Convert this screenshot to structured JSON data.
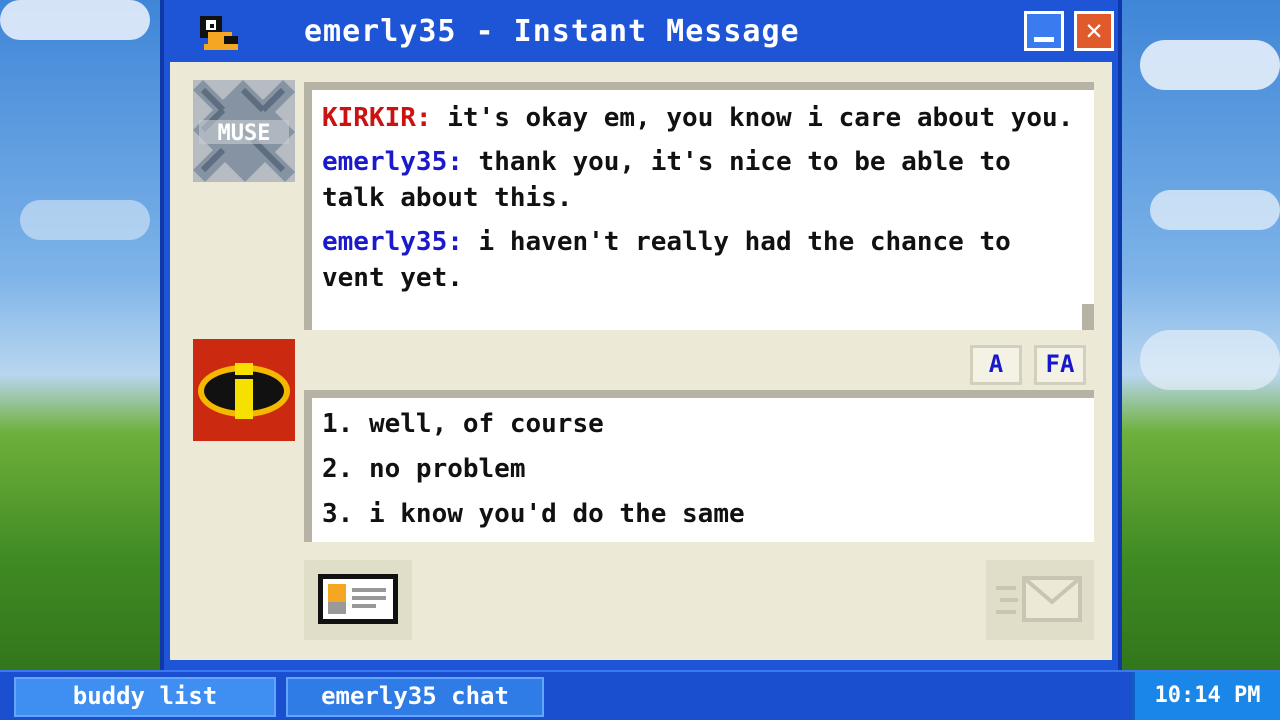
{
  "window": {
    "title": "emerly35 - Instant Message",
    "close_glyph": "✕",
    "icons": {
      "app": "duck-messenger-icon",
      "minimize": "minimize-icon",
      "close": "close-icon"
    }
  },
  "buddy_avatar": {
    "icon": "muse-avatar",
    "text": "MUSE"
  },
  "user_avatar": {
    "icon": "incredibles-logo-avatar"
  },
  "chat": {
    "messages": [
      {
        "sender": "KIRKIR:",
        "text": "it's okay em, you know i care about you.",
        "color": "#cc1111"
      },
      {
        "sender": "emerly35:",
        "text": "thank you, it's nice to be able to talk about this.",
        "color": "#1a1acc"
      },
      {
        "sender": "emerly35:",
        "text": "i haven't really had the chance to vent yet.",
        "color": "#1a1acc"
      }
    ]
  },
  "format_buttons": [
    {
      "label": "A",
      "icon": "font-icon"
    },
    {
      "label": "FA",
      "icon": "font-style-icon"
    }
  ],
  "reply_options": [
    "1. well, of course",
    "2. no problem",
    "3. i know you'd do the same"
  ],
  "buttons": {
    "profile_icon": "profile-card-icon",
    "send_icon": "send-envelope-icon"
  },
  "taskbar": {
    "tasks": [
      "buddy list",
      "emerly35 chat"
    ],
    "clock": "10:14 PM"
  },
  "colors": {
    "window_blue": "#1e55d6",
    "client_beige": "#ecead6",
    "buddy_name": "#cc1111",
    "user_name": "#1a1acc"
  }
}
